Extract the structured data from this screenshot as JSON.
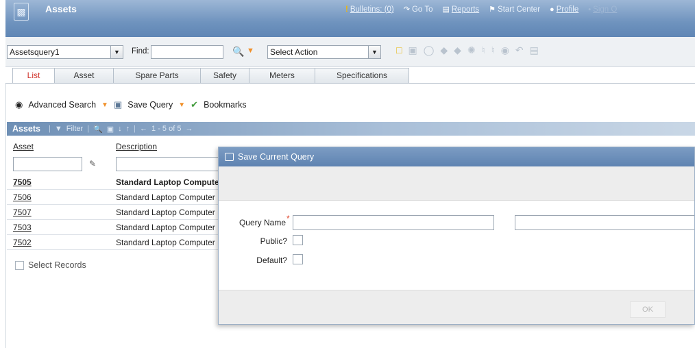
{
  "header": {
    "app_title": "Assets",
    "nav": {
      "bulletins": "Bulletins: (0)",
      "goto": "Go To",
      "reports": "Reports",
      "start_center": "Start Center",
      "profile": "Profile",
      "sign_out": "Sign O"
    }
  },
  "toolbar": {
    "query_value": "Assetsquery1",
    "find_label": "Find:",
    "find_value": "",
    "action_value": "Select Action",
    "icons": [
      "new-record-icon",
      "save-icon",
      "clear-icon",
      "previous-icon",
      "next-icon",
      "workflow-icon",
      "route-icon",
      "route-stop-icon",
      "help-icon",
      "undo-icon",
      "print-icon"
    ]
  },
  "tabs": [
    "List",
    "Asset",
    "Spare Parts",
    "Safety",
    "Meters",
    "Specifications"
  ],
  "search": {
    "advanced": "Advanced Search",
    "save_query": "Save Query",
    "bookmarks": "Bookmarks"
  },
  "results": {
    "title": "Assets",
    "filter": "Filter",
    "paging": "1 - 5 of 5",
    "columns": {
      "asset": "Asset",
      "description": "Description"
    },
    "rows": [
      {
        "asset": "7505",
        "description": "Standard Laptop Computer",
        "bold": true
      },
      {
        "asset": "7506",
        "description": "Standard Laptop Computer",
        "bold": false
      },
      {
        "asset": "7507",
        "description": "Standard Laptop Computer",
        "bold": false
      },
      {
        "asset": "7503",
        "description": "Standard Laptop Computer",
        "bold": false
      },
      {
        "asset": "7502",
        "description": "Standard Laptop Computer",
        "bold": false
      }
    ],
    "select_records": "Select Records"
  },
  "dialog": {
    "title": "Save Current Query",
    "query_name_label": "Query Name",
    "query_name_value": "",
    "query_description_value": "",
    "public_label": "Public?",
    "default_label": "Default?",
    "ok_label": "OK"
  },
  "colors": {
    "title_bar": "#6f93be",
    "active_tab_text": "#d0342c",
    "required_marker": "#e0462e",
    "dialog_title": "#5e83b1"
  }
}
